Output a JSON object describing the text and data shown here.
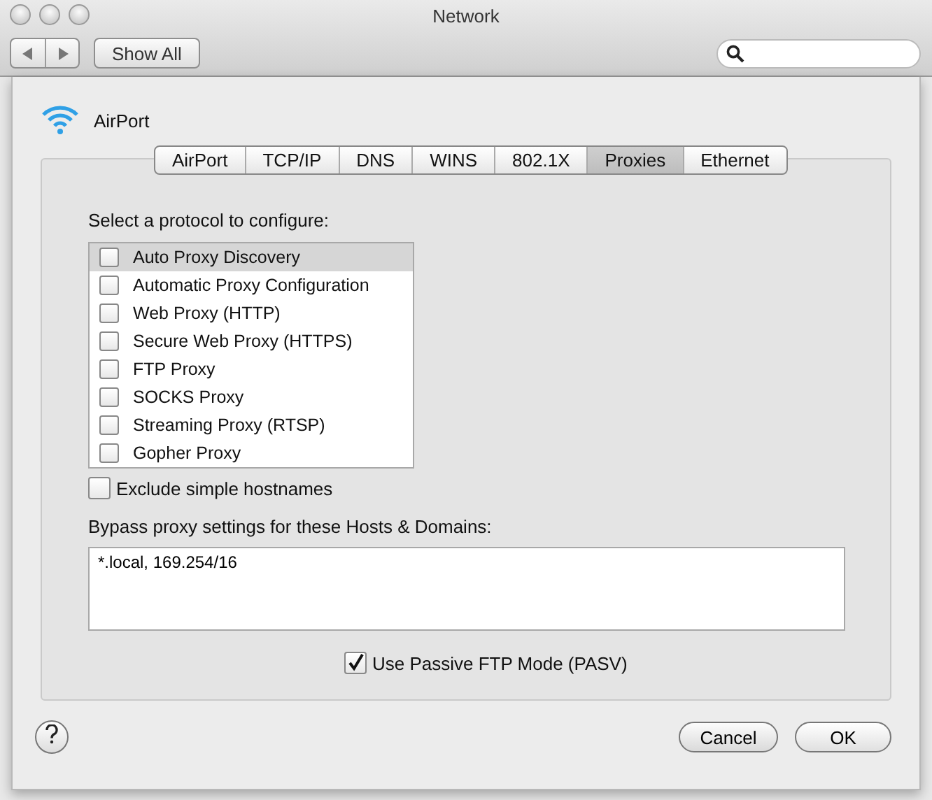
{
  "window": {
    "title": "Network"
  },
  "toolbar": {
    "show_all": "Show All"
  },
  "header": {
    "service": "AirPort"
  },
  "tabs": [
    {
      "label": "AirPort",
      "selected": false
    },
    {
      "label": "TCP/IP",
      "selected": false
    },
    {
      "label": "DNS",
      "selected": false
    },
    {
      "label": "WINS",
      "selected": false
    },
    {
      "label": "802.1X",
      "selected": false
    },
    {
      "label": "Proxies",
      "selected": true
    },
    {
      "label": "Ethernet",
      "selected": false
    }
  ],
  "protocols": {
    "label": "Select a protocol to configure:",
    "items": [
      {
        "label": "Auto Proxy Discovery",
        "checked": false,
        "selected": true
      },
      {
        "label": "Automatic Proxy Configuration",
        "checked": false,
        "selected": false
      },
      {
        "label": "Web Proxy (HTTP)",
        "checked": false,
        "selected": false
      },
      {
        "label": "Secure Web Proxy (HTTPS)",
        "checked": false,
        "selected": false
      },
      {
        "label": "FTP Proxy",
        "checked": false,
        "selected": false
      },
      {
        "label": "SOCKS Proxy",
        "checked": false,
        "selected": false
      },
      {
        "label": "Streaming Proxy (RTSP)",
        "checked": false,
        "selected": false
      },
      {
        "label": "Gopher Proxy",
        "checked": false,
        "selected": false
      }
    ]
  },
  "exclude_simple": {
    "label": "Exclude simple hostnames",
    "checked": false
  },
  "bypass": {
    "label": "Bypass proxy settings for these Hosts & Domains:",
    "value": "*.local, 169.254/16"
  },
  "passive_ftp": {
    "label": "Use Passive FTP Mode (PASV)",
    "checked": true
  },
  "buttons": [
    {
      "label": "Cancel",
      "kind": "cancel"
    },
    {
      "label": "OK",
      "kind": "default"
    }
  ]
}
